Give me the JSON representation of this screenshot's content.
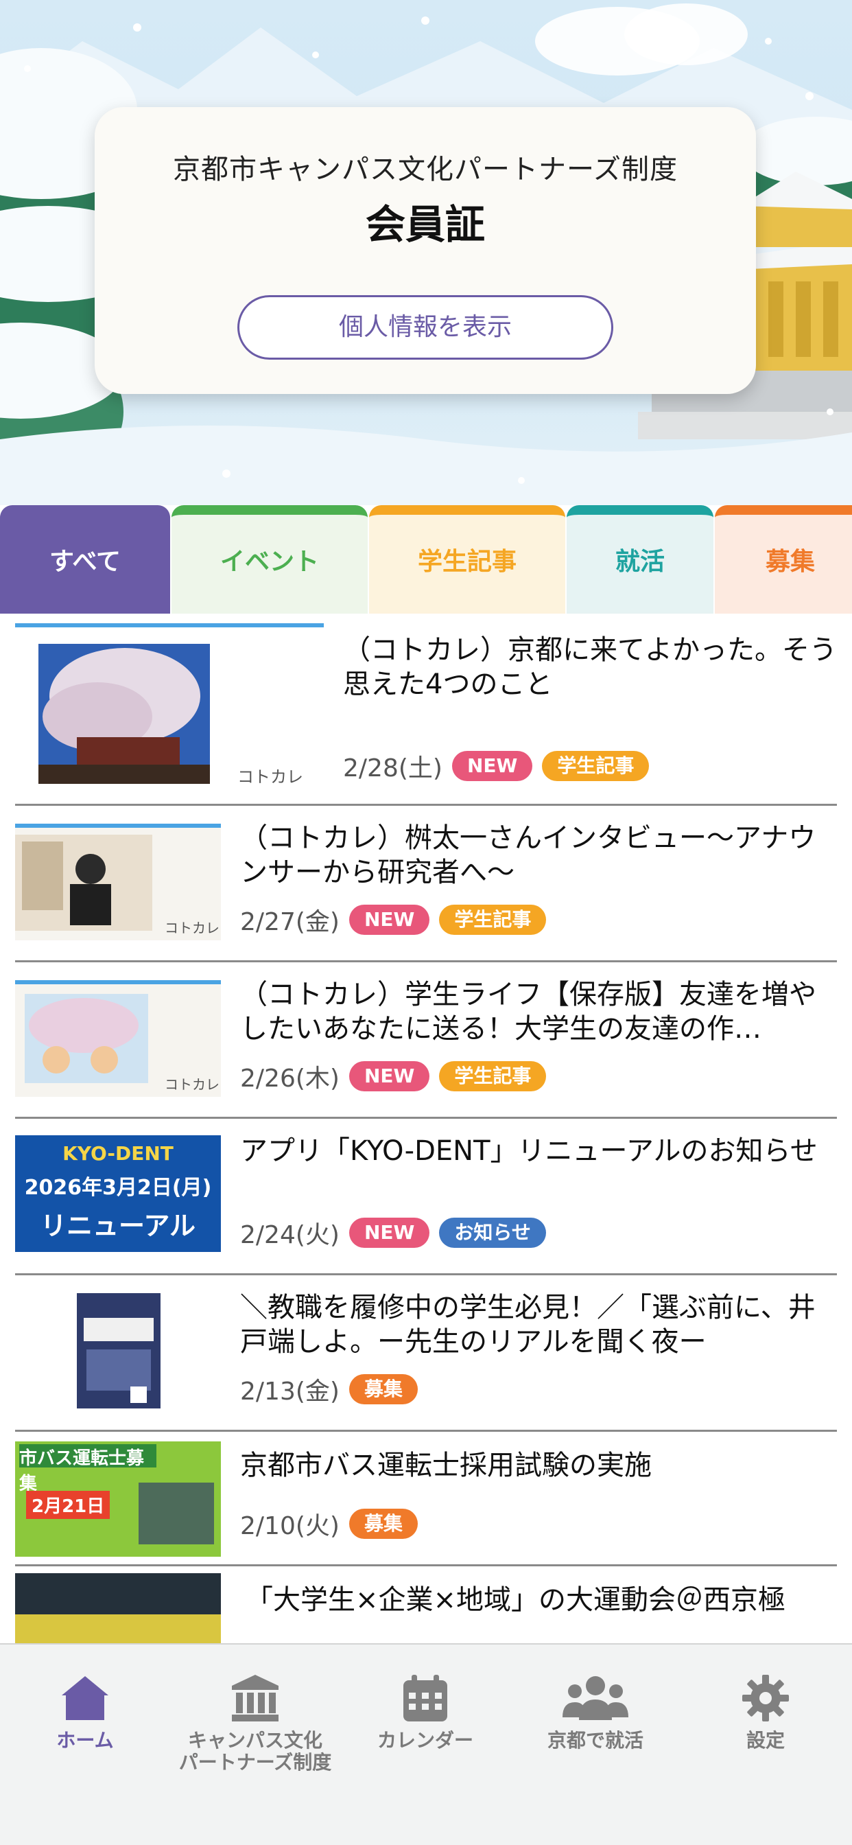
{
  "card": {
    "subtitle": "京都市キャンパス文化パートナーズ制度",
    "title": "会員証",
    "button_label": "個人情報を表示"
  },
  "tabs": [
    {
      "label": "すべて",
      "color": "#6a5ba6",
      "active": true
    },
    {
      "label": "イベント",
      "color": "#4caf50"
    },
    {
      "label": "学生記事",
      "color": "#f5a623"
    },
    {
      "label": "就活",
      "color": "#1ea3a0"
    },
    {
      "label": "募集",
      "color": "#f07a2a"
    }
  ],
  "articles": [
    {
      "title": "（コトカレ）京都に来てよかった。そう思えた4つのこと",
      "date": "2/28(土)",
      "tags": [
        "NEW",
        "学生記事"
      ],
      "thumb_caption": "コトカレ"
    },
    {
      "title": "（コトカレ）桝太一さんインタビュー～アナウンサーから研究者へ～",
      "date": "2/27(金)",
      "tags": [
        "NEW",
        "学生記事"
      ],
      "thumb_caption": "コトカレ"
    },
    {
      "title": "（コトカレ）学生ライフ【保存版】友達を増やしたいあなたに送る！大学生の友達の作…",
      "date": "2/26(木)",
      "tags": [
        "NEW",
        "学生記事"
      ],
      "thumb_caption": "コトカレ"
    },
    {
      "title": "アプリ「KYO-DENT」リニューアルのお知らせ",
      "date": "2/24(火)",
      "tags": [
        "NEW",
        "お知らせ"
      ],
      "thumb_lines": [
        "KYO-DENT",
        "2026年3月2日(月)",
        "リニューアル"
      ]
    },
    {
      "title": "＼教職を履修中の学生必見！／「選ぶ前に、井戸端しよ。ー先生のリアルを聞く夜ー",
      "date": "2/13(金)",
      "tags": [
        "募集"
      ]
    },
    {
      "title": "京都市バス運転士採用試験の実施",
      "date": "2/10(火)",
      "tags": [
        "募集"
      ],
      "thumb_lines": [
        "市バス運転士募集",
        "2月21日"
      ]
    },
    {
      "title": "「大学生×企業×地域」の大運動会＠西京極",
      "date": "",
      "tags": []
    }
  ],
  "tag_colors": {
    "NEW": "#e8577a",
    "学生記事": "#f5a623",
    "お知らせ": "#3f77c2",
    "募集": "#f07a2a"
  },
  "bottom_nav": [
    {
      "label": "ホーム",
      "icon": "home-icon",
      "active": true
    },
    {
      "label": "キャンパス文化\nパートナーズ制度",
      "icon": "building-icon"
    },
    {
      "label": "カレンダー",
      "icon": "calendar-icon"
    },
    {
      "label": "京都で就活",
      "icon": "people-icon"
    },
    {
      "label": "設定",
      "icon": "gear-icon"
    }
  ]
}
